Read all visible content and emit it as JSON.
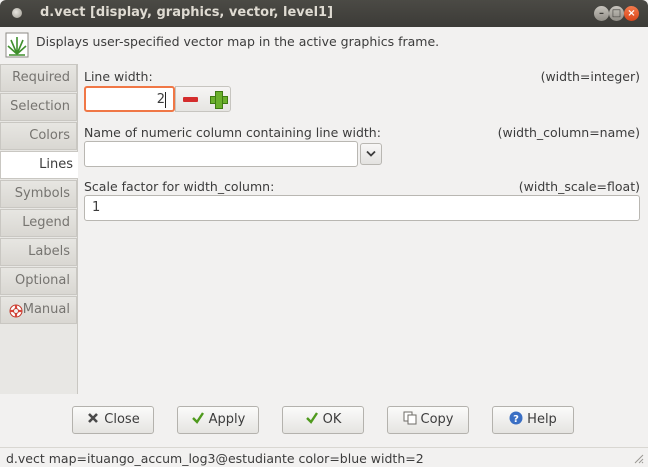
{
  "window": {
    "title": "d.vect [display, graphics, vector, level1]",
    "description": "Displays user-specified vector map in the active graphics frame."
  },
  "tabs": [
    {
      "label": "Required",
      "active": false
    },
    {
      "label": "Selection",
      "active": false
    },
    {
      "label": "Colors",
      "active": false
    },
    {
      "label": "Lines",
      "active": true
    },
    {
      "label": "Symbols",
      "active": false
    },
    {
      "label": "Legend",
      "active": false
    },
    {
      "label": "Labels",
      "active": false
    },
    {
      "label": "Optional",
      "active": false
    },
    {
      "label": "Manual",
      "active": false
    }
  ],
  "fields": {
    "width": {
      "label": "Line width:",
      "key": "(width=integer)",
      "value": "2"
    },
    "width_column": {
      "label": "Name of numeric column containing line width:",
      "key": "(width_column=name)",
      "value": ""
    },
    "width_scale": {
      "label": "Scale factor for width_column:",
      "key": "(width_scale=float)",
      "value": "1"
    }
  },
  "buttons": {
    "close": "Close",
    "apply": "Apply",
    "ok": "OK",
    "copy": "Copy",
    "help": "Help"
  },
  "status": {
    "command": "d.vect map=ituango_accum_log3@estudiante color=blue width=2"
  },
  "colors": {
    "titlebar": "#3c3b37",
    "focus_border": "#f07746",
    "close_button": "#e0542a"
  }
}
